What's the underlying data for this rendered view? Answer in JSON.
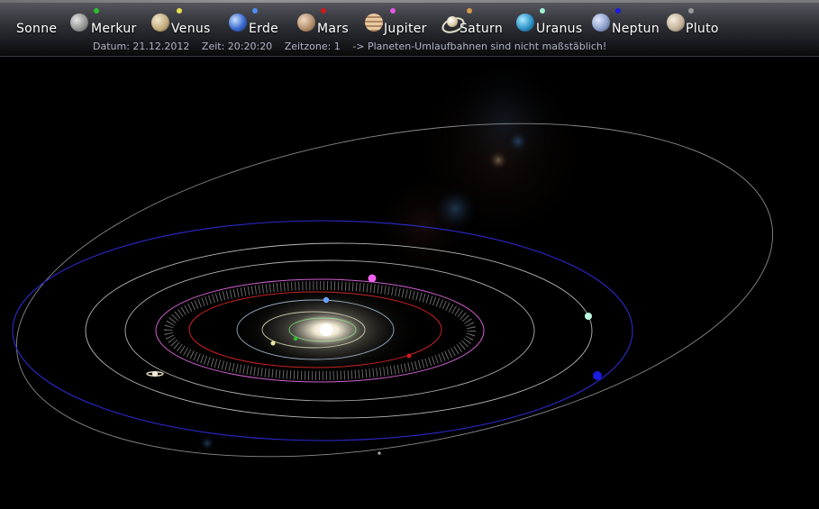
{
  "nav": [
    {
      "name": "sonne",
      "label": "Sonne",
      "marker": null,
      "icon": "#e8e2c8"
    },
    {
      "name": "merkur",
      "label": "Merkur",
      "marker": "#2ec02e",
      "icon": "#b9b9b9"
    },
    {
      "name": "venus",
      "label": "Venus",
      "marker": "#e6e04a",
      "icon": "#d9c9a2"
    },
    {
      "name": "erde",
      "label": "Erde",
      "marker": "#4d8ef0",
      "icon": "#4a7bd6"
    },
    {
      "name": "mars",
      "label": "Mars",
      "marker": "#cc1a1a",
      "icon": "#c8a98a"
    },
    {
      "name": "jupiter",
      "label": "Jupiter",
      "marker": "#e656e6",
      "icon": "#d8b48c"
    },
    {
      "name": "saturn",
      "label": "Saturn",
      "marker": "#d49a4a",
      "icon": "#e0d0a6"
    },
    {
      "name": "uranus",
      "label": "Uranus",
      "marker": "#9ff0d4",
      "icon": "#2e94c8"
    },
    {
      "name": "neptun",
      "label": "Neptun",
      "marker": "#1a1ae0",
      "icon": "#8ea0cc"
    },
    {
      "name": "pluto",
      "label": "Pluto",
      "marker": "#9a9a9a",
      "icon": "#cfc4b0"
    }
  ],
  "info": {
    "datum": "Datum:  21.12.2012",
    "zeit": "Zeit: 20:20:20",
    "zeitzone": "Zeitzone: 1",
    "hinweis": "->  Planeten-Umlaufbahnen sind nicht maßstäblich!"
  },
  "colors": {
    "mercury_orbit": "#2fc23a",
    "venus_orbit": "#f0f0c8",
    "earth_orbit": "#9ab0c8",
    "mars_orbit": "#cc2222",
    "jupiter_orbit": "#d060d0",
    "saturn_orbit": "#cfcfcf",
    "uranus_orbit": "#d8d8d8",
    "neptune_orbit": "#2a2acc",
    "pluto_orbit": "#b8b8b8"
  }
}
